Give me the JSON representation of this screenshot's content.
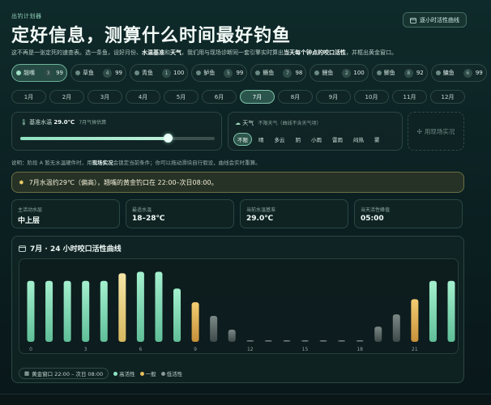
{
  "header": {
    "kicker": "出钓计划器",
    "title": "定好信息，测算什么时间最好钓鱼",
    "hourly_button": "逐小时活性曲线",
    "intro": {
      "p1": "这不再是一张定死的速查表。选一条鱼，设好月份、",
      "b1": "水温基准",
      "p2": "和",
      "b2": "天气",
      "p3": "，我们用与现场诊断同一套引擎实时算出",
      "b3": "当天每个钟点的咬口活性",
      "p4": "，并框出黄金窗口。"
    }
  },
  "fish": [
    {
      "name": "翘嘴",
      "count": "3",
      "score": "99",
      "active": true
    },
    {
      "name": "草鱼",
      "count": "4",
      "score": "99",
      "active": false
    },
    {
      "name": "青鱼",
      "count": "1",
      "score": "100",
      "active": false
    },
    {
      "name": "鲈鱼",
      "count": "5",
      "score": "99",
      "active": false
    },
    {
      "name": "鳜鱼",
      "count": "7",
      "score": "98",
      "active": false
    },
    {
      "name": "鲤鱼",
      "count": "2",
      "score": "100",
      "active": false
    },
    {
      "name": "鲫鱼",
      "count": "8",
      "score": "92",
      "active": false
    },
    {
      "name": "鳙鱼",
      "count": "6",
      "score": "99",
      "active": false
    }
  ],
  "months": [
    "1月",
    "2月",
    "3月",
    "4月",
    "5月",
    "6月",
    "7月",
    "8月",
    "9月",
    "10月",
    "11月",
    "12月"
  ],
  "active_month_index": 6,
  "water": {
    "label": "基准水温",
    "value": "29.0℃",
    "hint": "7月气候估算",
    "level": 0.76
  },
  "weather": {
    "label": "天气",
    "hint": "不限天气（曲线不含天气项）",
    "options": [
      "不限",
      "晴",
      "多云",
      "阴",
      "小雨",
      "雷雨",
      "闷热",
      "雾"
    ],
    "active_index": 0
  },
  "live_button": "用现场实况",
  "note": {
    "p1": "说明：阶段 A 暂无水温硬件时，用",
    "b1": "现场实况",
    "p2": "会锁定当前条件；你可以拖动滑块自行假设，曲线会实时重算。"
  },
  "banner": "7月水温约29℃（偏高），翘嘴的黄金钓口在 22:00–次日08:00。",
  "stats": [
    {
      "label": "主活动水层",
      "value": "中上层"
    },
    {
      "label": "最适水温",
      "value": "18–28℃"
    },
    {
      "label": "当前水温基准",
      "value": "29.0℃"
    },
    {
      "label": "当天活性峰值",
      "value": "05:00"
    }
  ],
  "chart": {
    "title": "7月 · 24 小时咬口活性曲线",
    "window_chip": "黄金窗口 22:00 – 次日 08:00",
    "legend": [
      {
        "label": "高活性",
        "color": "#8fe6c2"
      },
      {
        "label": "一般",
        "color": "#e8bd5c"
      },
      {
        "label": "低活性",
        "color": "#8a9a98"
      }
    ]
  },
  "chart_data": {
    "type": "bar",
    "categories": [
      "0",
      "1",
      "2",
      "3",
      "4",
      "5",
      "6",
      "7",
      "8",
      "9",
      "10",
      "11",
      "12",
      "13",
      "14",
      "15",
      "16",
      "17",
      "18",
      "19",
      "20",
      "21",
      "22",
      "23"
    ],
    "tick_labels": [
      "0",
      "3",
      "6",
      "9",
      "12",
      "15",
      "18",
      "21"
    ],
    "values": [
      80,
      80,
      80,
      80,
      80,
      90,
      92,
      92,
      70,
      52,
      34,
      16,
      2,
      2,
      2,
      2,
      2,
      2,
      2,
      20,
      36,
      56,
      80,
      80
    ],
    "levels": [
      "high",
      "high",
      "high",
      "high",
      "high",
      "peak",
      "high",
      "high",
      "high",
      "mid",
      "low",
      "low",
      "low",
      "low",
      "low",
      "low",
      "low",
      "low",
      "low",
      "low",
      "low",
      "mid",
      "high",
      "high"
    ],
    "ylim": [
      0,
      100
    ]
  }
}
